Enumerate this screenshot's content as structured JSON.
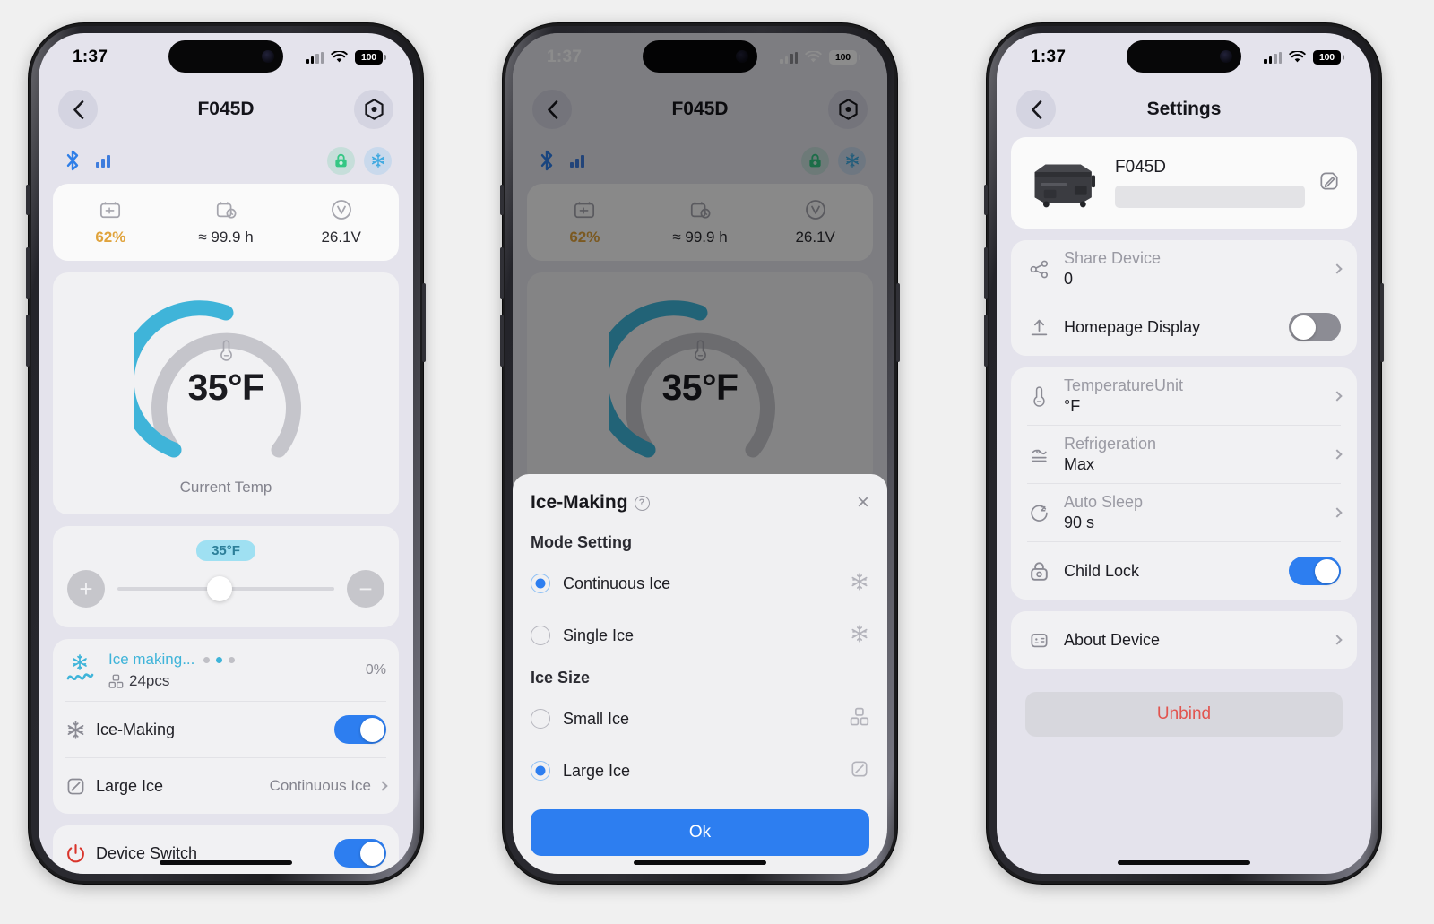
{
  "status_bar": {
    "time": "1:37",
    "battery": "100",
    "signal_icon": "cellular-bars-icon",
    "wifi_icon": "wifi-icon"
  },
  "phone1": {
    "nav": {
      "back_icon": "chevron-left-icon",
      "title": "F045D",
      "settings_icon": "gear-hex-icon"
    },
    "connectivity": {
      "bluetooth_icon": "bluetooth-icon",
      "signal_icon": "signal-bars-icon",
      "lock_badge_icon": "child-lock-icon",
      "cool_badge_icon": "snowflake-icon",
      "lock_color": "#34c784",
      "cool_color": "#3fa9e0"
    },
    "metrics": [
      {
        "icon": "battery-icon",
        "value": "62%",
        "accent": "#e0a33c"
      },
      {
        "icon": "battery-time-icon",
        "value": "≈ 99.9 h",
        "accent": ""
      },
      {
        "icon": "voltage-icon",
        "value": "26.1V",
        "accent": ""
      }
    ],
    "gauge": {
      "icon": "thermometer-icon",
      "value": "35°F",
      "label": "Current Temp",
      "arc_color": "#3fb4d9",
      "track_color": "#c5c5cb",
      "percent": 44
    },
    "slider": {
      "badge": "35°F",
      "plus_label": "+",
      "minus_label": "−",
      "knob_percent": 47
    },
    "ice_status": {
      "wave_icon": "ice-wave-icon",
      "title": "Ice making...",
      "dots_active_index": 1,
      "pieces_icon": "ice-cubes-icon",
      "pieces": "24pcs",
      "percent": "0%"
    },
    "rows": [
      {
        "icon": "snowflake-icon",
        "label": "Ice-Making",
        "control": "toggle",
        "toggle_on": true
      },
      {
        "icon": "large-ice-icon",
        "label": "Large Ice",
        "control": "value",
        "value": "Continuous Ice"
      }
    ],
    "device_switch": {
      "icon": "power-icon",
      "label": "Device Switch",
      "toggle_on": true,
      "icon_color": "#d9342b"
    }
  },
  "phone2": {
    "nav": {
      "back_icon": "chevron-left-icon",
      "title": "F045D",
      "settings_icon": "gear-hex-icon"
    },
    "metrics": [
      {
        "icon": "battery-icon",
        "value": "62%"
      },
      {
        "icon": "battery-time-icon",
        "value": "≈ 99.9 h"
      },
      {
        "icon": "voltage-icon",
        "value": "26.1V"
      }
    ],
    "gauge": {
      "value": "35°F",
      "icon": "thermometer-icon"
    },
    "sheet": {
      "title": "Ice-Making",
      "help_icon": "question-circle-icon",
      "help_glyph": "?",
      "close_icon": "close-icon",
      "close_glyph": "×",
      "sections": [
        {
          "title": "Mode Setting",
          "options": [
            {
              "label": "Continuous Ice",
              "selected": true,
              "icon": "snowflake-icon"
            },
            {
              "label": "Single Ice",
              "selected": false,
              "icon": "snowflake-icon"
            }
          ]
        },
        {
          "title": "Ice Size",
          "options": [
            {
              "label": "Small Ice",
              "selected": false,
              "icon": "small-ice-icon"
            },
            {
              "label": "Large Ice",
              "selected": true,
              "icon": "large-ice-icon"
            }
          ]
        }
      ],
      "ok_label": "Ok",
      "ok_color": "#2d7ef0"
    }
  },
  "phone3": {
    "nav": {
      "back_icon": "chevron-left-icon",
      "title": "Settings"
    },
    "device": {
      "thumb_icon": "portable-fridge-icon",
      "name": "F045D",
      "edit_icon": "edit-pencil-icon"
    },
    "group1": [
      {
        "icon": "share-icon",
        "label": "Share Device",
        "value": "0",
        "control": "chevron"
      },
      {
        "icon": "upload-icon",
        "label": "Homepage Display",
        "value": "",
        "control": "toggle",
        "toggle_on": false
      }
    ],
    "group2": [
      {
        "icon": "thermometer-icon",
        "label": "TemperatureUnit",
        "value": "°F",
        "control": "chevron"
      },
      {
        "icon": "refrigeration-icon",
        "label": "Refrigeration",
        "value": "Max",
        "control": "chevron"
      },
      {
        "icon": "auto-sleep-icon",
        "label": "Auto Sleep",
        "value": "90 s",
        "control": "chevron"
      },
      {
        "icon": "child-lock-icon",
        "label": "Child Lock",
        "value": "",
        "control": "toggle",
        "toggle_on": true
      }
    ],
    "group3": [
      {
        "icon": "about-device-icon",
        "label": "About Device",
        "value": "",
        "control": "chevron"
      }
    ],
    "unbind_label": "Unbind",
    "unbind_color": "#e2544f"
  }
}
